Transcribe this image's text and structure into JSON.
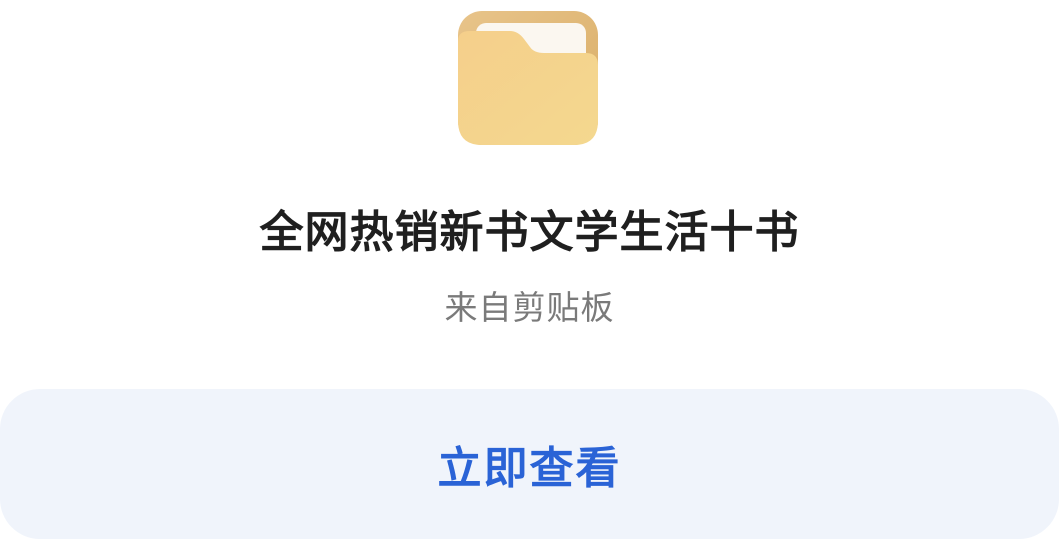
{
  "clipboard_card": {
    "icon": "folder-icon",
    "title": "全网热销新书文学生活十书",
    "source": "来自剪贴板",
    "action_label": "立即查看"
  },
  "colors": {
    "accent": "#2a63d6",
    "button_bg": "#f0f4fb",
    "folder_back": "#e4bf7e",
    "folder_front": "#f3cf87",
    "paper": "#fbf7f0",
    "title": "#1f1f1f",
    "subtitle": "#7a7a7a"
  }
}
